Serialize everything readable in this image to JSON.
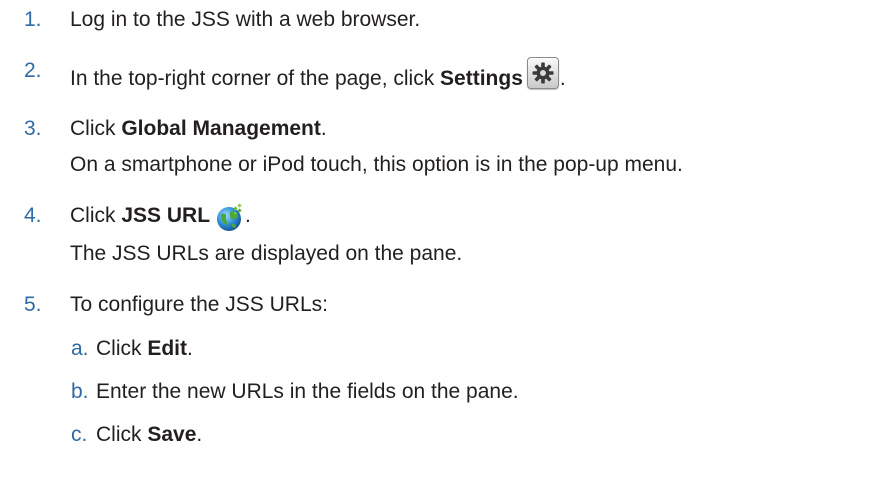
{
  "steps": [
    {
      "num": "1.",
      "text": "Log in to the JSS with a web browser."
    },
    {
      "num": "2.",
      "pre": "In the top-right corner of the page, click ",
      "bold": "Settings",
      "icon": "gear-icon",
      "post": "."
    },
    {
      "num": "3.",
      "pre": "Click ",
      "bold": "Global Management",
      "post": ".",
      "note": "On a smartphone or iPod touch, this option is in the pop-up menu."
    },
    {
      "num": "4.",
      "pre": "Click ",
      "bold": "JSS URL",
      "icon": "globe-icon",
      "post": ".",
      "note": "The JSS URLs are displayed on the pane."
    },
    {
      "num": "5.",
      "text": "To configure the JSS URLs:"
    }
  ],
  "substeps": [
    {
      "letter": "a.",
      "pre": "Click ",
      "bold": "Edit",
      "post": "."
    },
    {
      "letter": "b.",
      "text": "Enter the new URLs in the fields on the pane."
    },
    {
      "letter": "c.",
      "pre": "Click ",
      "bold": "Save",
      "post": "."
    }
  ],
  "colors": {
    "number": "#2e6aa5",
    "text": "#231f20"
  }
}
